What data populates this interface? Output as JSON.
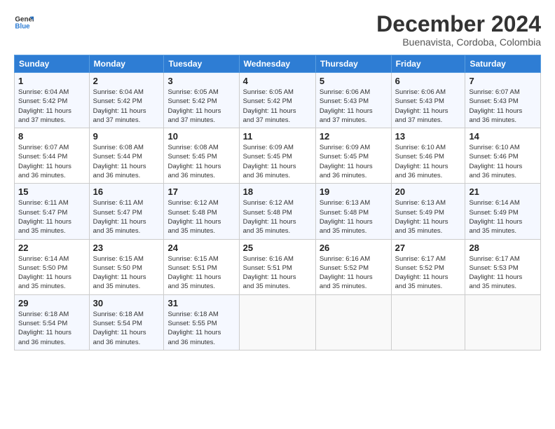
{
  "header": {
    "logo_line1": "General",
    "logo_line2": "Blue",
    "month": "December 2024",
    "location": "Buenavista, Cordoba, Colombia"
  },
  "weekdays": [
    "Sunday",
    "Monday",
    "Tuesday",
    "Wednesday",
    "Thursday",
    "Friday",
    "Saturday"
  ],
  "weeks": [
    [
      {
        "day": "1",
        "info": "Sunrise: 6:04 AM\nSunset: 5:42 PM\nDaylight: 11 hours\nand 37 minutes."
      },
      {
        "day": "2",
        "info": "Sunrise: 6:04 AM\nSunset: 5:42 PM\nDaylight: 11 hours\nand 37 minutes."
      },
      {
        "day": "3",
        "info": "Sunrise: 6:05 AM\nSunset: 5:42 PM\nDaylight: 11 hours\nand 37 minutes."
      },
      {
        "day": "4",
        "info": "Sunrise: 6:05 AM\nSunset: 5:42 PM\nDaylight: 11 hours\nand 37 minutes."
      },
      {
        "day": "5",
        "info": "Sunrise: 6:06 AM\nSunset: 5:43 PM\nDaylight: 11 hours\nand 37 minutes."
      },
      {
        "day": "6",
        "info": "Sunrise: 6:06 AM\nSunset: 5:43 PM\nDaylight: 11 hours\nand 37 minutes."
      },
      {
        "day": "7",
        "info": "Sunrise: 6:07 AM\nSunset: 5:43 PM\nDaylight: 11 hours\nand 36 minutes."
      }
    ],
    [
      {
        "day": "8",
        "info": "Sunrise: 6:07 AM\nSunset: 5:44 PM\nDaylight: 11 hours\nand 36 minutes."
      },
      {
        "day": "9",
        "info": "Sunrise: 6:08 AM\nSunset: 5:44 PM\nDaylight: 11 hours\nand 36 minutes."
      },
      {
        "day": "10",
        "info": "Sunrise: 6:08 AM\nSunset: 5:45 PM\nDaylight: 11 hours\nand 36 minutes."
      },
      {
        "day": "11",
        "info": "Sunrise: 6:09 AM\nSunset: 5:45 PM\nDaylight: 11 hours\nand 36 minutes."
      },
      {
        "day": "12",
        "info": "Sunrise: 6:09 AM\nSunset: 5:45 PM\nDaylight: 11 hours\nand 36 minutes."
      },
      {
        "day": "13",
        "info": "Sunrise: 6:10 AM\nSunset: 5:46 PM\nDaylight: 11 hours\nand 36 minutes."
      },
      {
        "day": "14",
        "info": "Sunrise: 6:10 AM\nSunset: 5:46 PM\nDaylight: 11 hours\nand 36 minutes."
      }
    ],
    [
      {
        "day": "15",
        "info": "Sunrise: 6:11 AM\nSunset: 5:47 PM\nDaylight: 11 hours\nand 35 minutes."
      },
      {
        "day": "16",
        "info": "Sunrise: 6:11 AM\nSunset: 5:47 PM\nDaylight: 11 hours\nand 35 minutes."
      },
      {
        "day": "17",
        "info": "Sunrise: 6:12 AM\nSunset: 5:48 PM\nDaylight: 11 hours\nand 35 minutes."
      },
      {
        "day": "18",
        "info": "Sunrise: 6:12 AM\nSunset: 5:48 PM\nDaylight: 11 hours\nand 35 minutes."
      },
      {
        "day": "19",
        "info": "Sunrise: 6:13 AM\nSunset: 5:48 PM\nDaylight: 11 hours\nand 35 minutes."
      },
      {
        "day": "20",
        "info": "Sunrise: 6:13 AM\nSunset: 5:49 PM\nDaylight: 11 hours\nand 35 minutes."
      },
      {
        "day": "21",
        "info": "Sunrise: 6:14 AM\nSunset: 5:49 PM\nDaylight: 11 hours\nand 35 minutes."
      }
    ],
    [
      {
        "day": "22",
        "info": "Sunrise: 6:14 AM\nSunset: 5:50 PM\nDaylight: 11 hours\nand 35 minutes."
      },
      {
        "day": "23",
        "info": "Sunrise: 6:15 AM\nSunset: 5:50 PM\nDaylight: 11 hours\nand 35 minutes."
      },
      {
        "day": "24",
        "info": "Sunrise: 6:15 AM\nSunset: 5:51 PM\nDaylight: 11 hours\nand 35 minutes."
      },
      {
        "day": "25",
        "info": "Sunrise: 6:16 AM\nSunset: 5:51 PM\nDaylight: 11 hours\nand 35 minutes."
      },
      {
        "day": "26",
        "info": "Sunrise: 6:16 AM\nSunset: 5:52 PM\nDaylight: 11 hours\nand 35 minutes."
      },
      {
        "day": "27",
        "info": "Sunrise: 6:17 AM\nSunset: 5:52 PM\nDaylight: 11 hours\nand 35 minutes."
      },
      {
        "day": "28",
        "info": "Sunrise: 6:17 AM\nSunset: 5:53 PM\nDaylight: 11 hours\nand 35 minutes."
      }
    ],
    [
      {
        "day": "29",
        "info": "Sunrise: 6:18 AM\nSunset: 5:54 PM\nDaylight: 11 hours\nand 36 minutes."
      },
      {
        "day": "30",
        "info": "Sunrise: 6:18 AM\nSunset: 5:54 PM\nDaylight: 11 hours\nand 36 minutes."
      },
      {
        "day": "31",
        "info": "Sunrise: 6:18 AM\nSunset: 5:55 PM\nDaylight: 11 hours\nand 36 minutes."
      },
      {
        "day": "",
        "info": ""
      },
      {
        "day": "",
        "info": ""
      },
      {
        "day": "",
        "info": ""
      },
      {
        "day": "",
        "info": ""
      }
    ]
  ]
}
